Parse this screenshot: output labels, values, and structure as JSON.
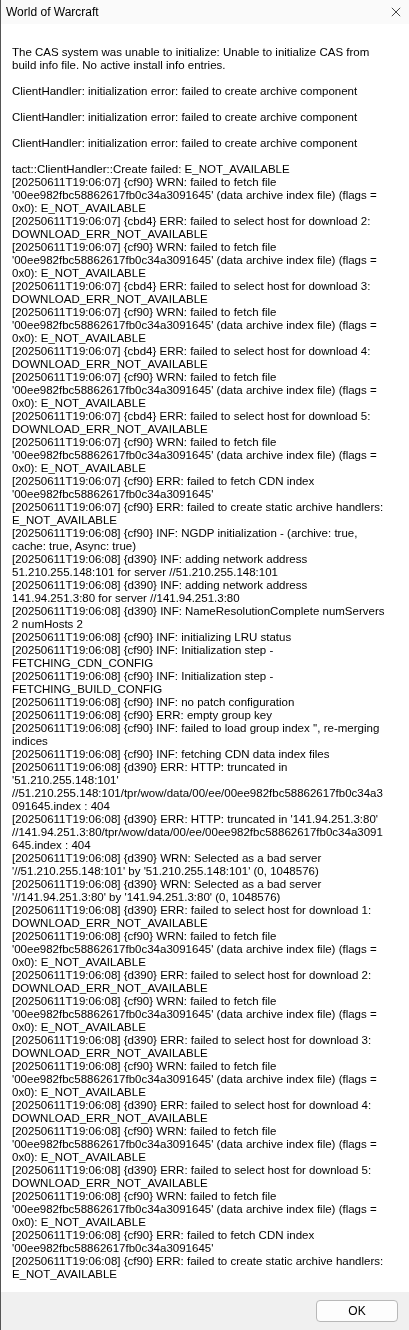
{
  "window": {
    "title": "World of Warcraft"
  },
  "message_blocks": [
    {
      "lines": [
        "The CAS system was unable to initialize: Unable to initialize CAS from build info file. No active install info entries."
      ]
    },
    {
      "lines": [
        "ClientHandler: initialization error: failed to create archive component"
      ]
    },
    {
      "lines": [
        "ClientHandler: initialization error: failed to create archive component"
      ]
    },
    {
      "lines": [
        "ClientHandler: initialization error: failed to create archive component"
      ]
    },
    {
      "lines": [
        "tact::ClientHandler::Create failed: E_NOT_AVAILABLE",
        "[20250611T19:06:07] {cf90} WRN: failed to fetch file '00ee982fbc58862617fb0c34a3091645' (data archive index file) (flags = 0x0): E_NOT_AVAILABLE",
        "[20250611T19:06:07] {cbd4} ERR: failed to select host for download 2: DOWNLOAD_ERR_NOT_AVAILABLE",
        "[20250611T19:06:07] {cf90} WRN: failed to fetch file '00ee982fbc58862617fb0c34a3091645' (data archive index file) (flags = 0x0): E_NOT_AVAILABLE",
        "[20250611T19:06:07] {cbd4} ERR: failed to select host for download 3: DOWNLOAD_ERR_NOT_AVAILABLE",
        "[20250611T19:06:07] {cf90} WRN: failed to fetch file '00ee982fbc58862617fb0c34a3091645' (data archive index file) (flags = 0x0): E_NOT_AVAILABLE",
        "[20250611T19:06:07] {cbd4} ERR: failed to select host for download 4: DOWNLOAD_ERR_NOT_AVAILABLE",
        "[20250611T19:06:07] {cf90} WRN: failed to fetch file '00ee982fbc58862617fb0c34a3091645' (data archive index file) (flags = 0x0): E_NOT_AVAILABLE",
        "[20250611T19:06:07] {cbd4} ERR: failed to select host for download 5: DOWNLOAD_ERR_NOT_AVAILABLE",
        "[20250611T19:06:07] {cf90} WRN: failed to fetch file '00ee982fbc58862617fb0c34a3091645' (data archive index file) (flags = 0x0): E_NOT_AVAILABLE",
        "[20250611T19:06:07] {cf90} ERR: failed to fetch CDN index '00ee982fbc58862617fb0c34a3091645'",
        "[20250611T19:06:07] {cf90} ERR: failed to create static archive handlers: E_NOT_AVAILABLE",
        "[20250611T19:06:08] {cf90} INF: NGDP initialization - (archive: true, cache: true, Async: true)",
        "[20250611T19:06:08] {d390} INF: adding network address 51.210.255.148:101 for server //51.210.255.148:101",
        "[20250611T19:06:08] {d390} INF: adding network address 141.94.251.3:80 for server //141.94.251.3:80",
        "[20250611T19:06:08] {d390} INF: NameResolutionComplete numServers 2 numHosts 2",
        "[20250611T19:06:08] {cf90} INF: initializing LRU status",
        "[20250611T19:06:08] {cf90} INF: Initialization step - FETCHING_CDN_CONFIG",
        "[20250611T19:06:08] {cf90} INF: Initialization step - FETCHING_BUILD_CONFIG",
        "[20250611T19:06:08] {cf90} INF: no patch configuration",
        "[20250611T19:06:08] {cf90} ERR: empty group key",
        "[20250611T19:06:08] {cf90} INF: failed to load group index '', re-merging indices",
        "[20250611T19:06:08] {cf90} INF: fetching CDN data index files",
        "[20250611T19:06:08] {d390} ERR: HTTP: truncated in '51.210.255.148:101' //51.210.255.148:101/tpr/wow/data/00/ee/00ee982fbc58862617fb0c34a3091645.index : 404",
        "[20250611T19:06:08] {d390} ERR: HTTP: truncated in '141.94.251.3:80' //141.94.251.3:80/tpr/wow/data/00/ee/00ee982fbc58862617fb0c34a3091645.index : 404",
        "[20250611T19:06:08] {d390} WRN: Selected as a bad server '//51.210.255.148:101' by '51.210.255.148:101' (0, 1048576)",
        "[20250611T19:06:08] {d390} WRN: Selected as a bad server '//141.94.251.3:80' by '141.94.251.3:80' (0, 1048576)",
        "[20250611T19:06:08] {d390} ERR: failed to select host for download 1: DOWNLOAD_ERR_NOT_AVAILABLE",
        "[20250611T19:06:08] {cf90} WRN: failed to fetch file '00ee982fbc58862617fb0c34a3091645' (data archive index file) (flags = 0x0): E_NOT_AVAILABLE",
        "[20250611T19:06:08] {d390} ERR: failed to select host for download 2: DOWNLOAD_ERR_NOT_AVAILABLE",
        "[20250611T19:06:08] {cf90} WRN: failed to fetch file '00ee982fbc58862617fb0c34a3091645' (data archive index file) (flags = 0x0): E_NOT_AVAILABLE",
        "[20250611T19:06:08] {d390} ERR: failed to select host for download 3: DOWNLOAD_ERR_NOT_AVAILABLE",
        "[20250611T19:06:08] {cf90} WRN: failed to fetch file '00ee982fbc58862617fb0c34a3091645' (data archive index file) (flags = 0x0): E_NOT_AVAILABLE",
        "[20250611T19:06:08] {d390} ERR: failed to select host for download 4: DOWNLOAD_ERR_NOT_AVAILABLE",
        "[20250611T19:06:08] {cf90} WRN: failed to fetch file '00ee982fbc58862617fb0c34a3091645' (data archive index file) (flags = 0x0): E_NOT_AVAILABLE",
        "[20250611T19:06:08] {d390} ERR: failed to select host for download 5: DOWNLOAD_ERR_NOT_AVAILABLE",
        "[20250611T19:06:08] {cf90} WRN: failed to fetch file '00ee982fbc58862617fb0c34a3091645' (data archive index file) (flags = 0x0): E_NOT_AVAILABLE",
        "[20250611T19:06:08] {cf90} ERR: failed to fetch CDN index '00ee982fbc58862617fb0c34a3091645'",
        "[20250611T19:06:08] {cf90} ERR: failed to create static archive handlers: E_NOT_AVAILABLE"
      ]
    }
  ],
  "buttons": [
    {
      "label": "OK"
    }
  ]
}
